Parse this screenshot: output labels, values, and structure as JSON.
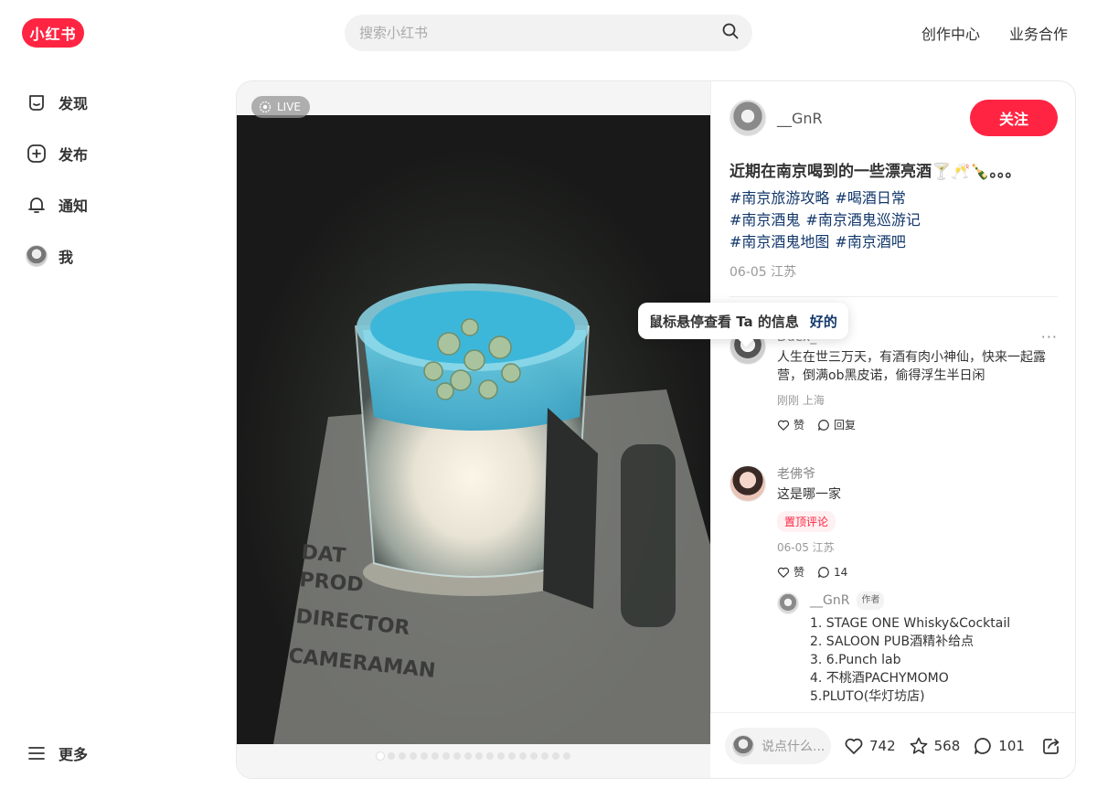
{
  "app": {
    "logo_text": "小红书",
    "brand_color": "#ff2442"
  },
  "search": {
    "placeholder": "搜索小红书",
    "icon": "search-icon"
  },
  "topnav": {
    "creator_center": "创作中心",
    "business": "业务合作"
  },
  "sidebar": {
    "items": [
      {
        "label": "发现",
        "icon": "home-icon"
      },
      {
        "label": "发布",
        "icon": "plus-square-icon"
      },
      {
        "label": "通知",
        "icon": "bell-icon"
      },
      {
        "label": "我",
        "icon": "avatar"
      }
    ],
    "more": {
      "label": "更多",
      "icon": "menu-icon"
    }
  },
  "media": {
    "live_label": "LIVE",
    "image_count": 18,
    "current_index": 0
  },
  "note": {
    "author": "__GnR",
    "follow_label": "关注",
    "title": "近期在南京喝到的一些漂亮酒🍸🥂🍾。。。",
    "tags": [
      "#南京旅游攻略",
      "#喝酒日常",
      "#南京酒鬼",
      "#南京酒鬼巡游记",
      "#南京酒鬼地图",
      "#南京酒吧"
    ],
    "date": "06-05 江苏"
  },
  "tooltip": {
    "text": "鼠标悬停查看 Ta 的信息",
    "ok": "好的"
  },
  "comments": [
    {
      "name": "Duex_",
      "text": "人生在世三万天，有酒有肉小神仙，快来一起露营，倒满ob黑皮诺，偷得浮生半日闲",
      "meta": "刚刚 上海",
      "like_label": "赞",
      "reply_label": "回复",
      "more": "···"
    },
    {
      "name": "老佛爷",
      "text": "这是哪一家",
      "pin": "置顶评论",
      "meta": "06-05 江苏",
      "like_label": "赞",
      "reply_count": "14",
      "reply": {
        "name": "__GnR",
        "badge": "作者",
        "lines": [
          "1. STAGE ONE Whisky&Cocktail",
          "2. SALOON PUB酒精补给点",
          "3. 6.Punch lab",
          "4. 不桃酒PACHYMOMO",
          "5.PLUTO(华灯坊店)"
        ]
      }
    }
  ],
  "bottom": {
    "input_placeholder": "说点什么...",
    "likes": "742",
    "collects": "568",
    "comments": "101"
  }
}
